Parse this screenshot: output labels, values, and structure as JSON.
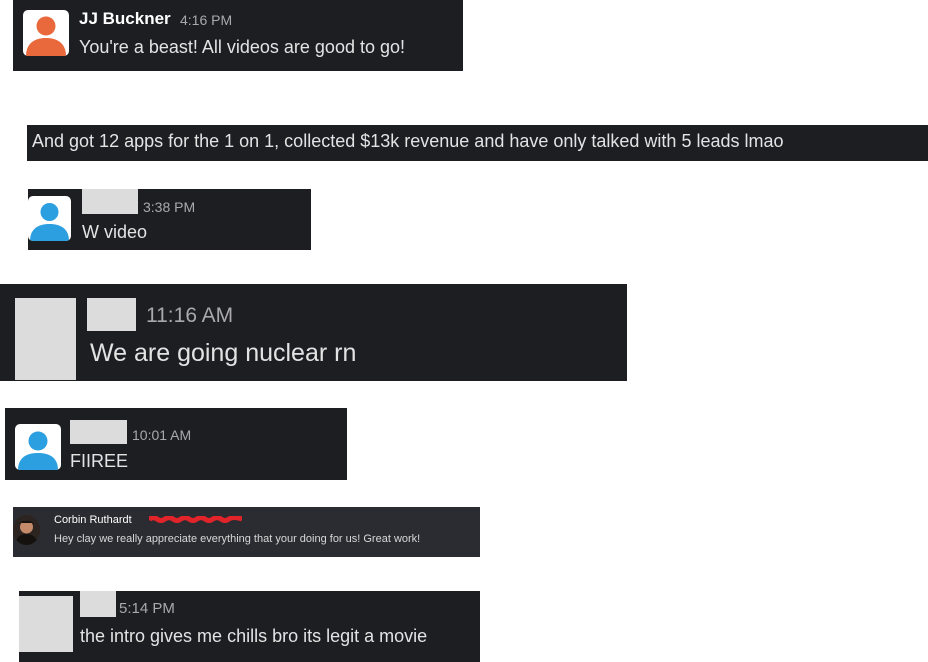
{
  "colors": {
    "card_bg": "#1d1e22",
    "text": "#e3e3e3",
    "timestamp": "#a9a9ad",
    "avatar_orange": "#e9683c",
    "avatar_blue": "#2c9fe0",
    "placeholder_gray": "#dcdcdc",
    "redaction_red": "#e0242a"
  },
  "messages": [
    {
      "author": "JJ Buckner",
      "time": "4:16 PM",
      "text": "You're a beast! All videos are good to go!",
      "avatar_icon": "user-avatar-orange-icon"
    },
    {
      "text": "And got 12 apps for the 1 on 1, collected $13k revenue and have only talked with 5 leads lmao"
    },
    {
      "time": "3:38 PM",
      "text": "W video",
      "avatar_icon": "user-avatar-blue-icon"
    },
    {
      "time": "11:16 AM",
      "text": "We are going nuclear rn"
    },
    {
      "time": "10:01 AM",
      "text": "FIIREE",
      "avatar_icon": "user-avatar-blue-icon"
    },
    {
      "author": "Corbin Ruthardt",
      "text": "Hey clay we really appreciate everything that your doing for us! Great work!",
      "avatar_icon": "profile-photo-icon"
    },
    {
      "time": "5:14 PM",
      "text": "the intro gives me chills bro its legit a movie"
    }
  ]
}
